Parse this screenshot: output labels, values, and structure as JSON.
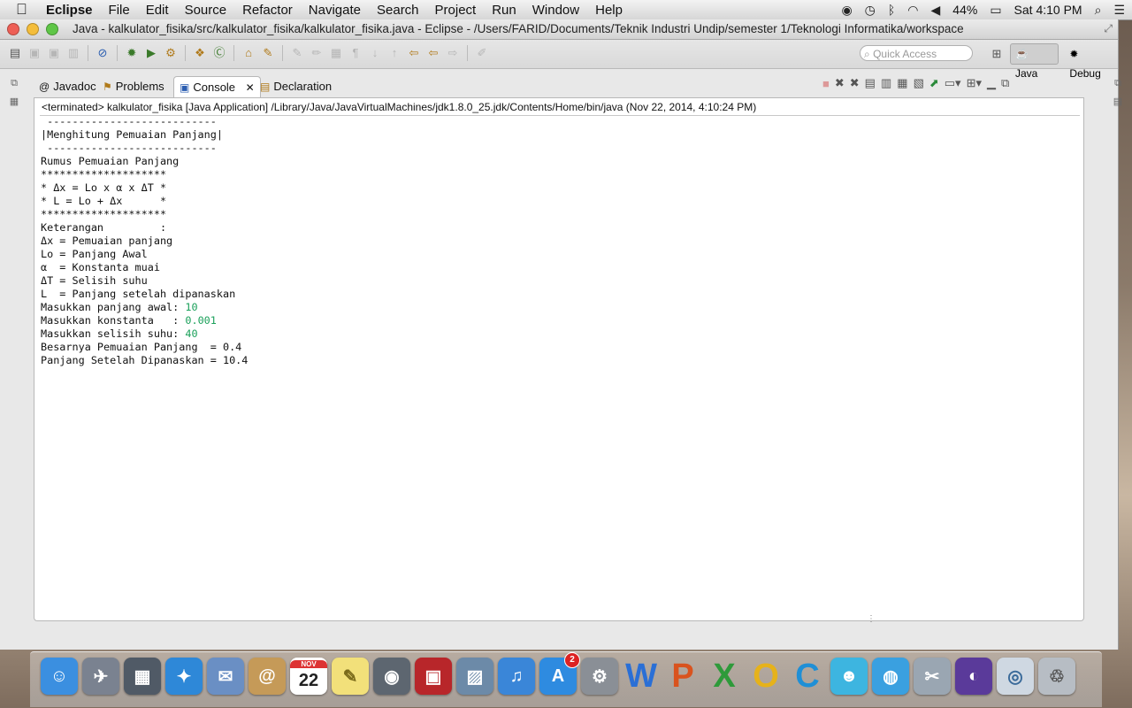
{
  "menubar": {
    "app_name": "Eclipse",
    "items": [
      "File",
      "Edit",
      "Source",
      "Refactor",
      "Navigate",
      "Search",
      "Project",
      "Run",
      "Window",
      "Help"
    ],
    "battery": "44%",
    "clock": "Sat 4:10 PM"
  },
  "window": {
    "title": "Java - kalkulator_fisika/src/kalkulator_fisika/kalkulator_fisika.java - Eclipse - /Users/FARID/Documents/Teknik Industri Undip/semester 1/Teknologi Informatika/workspace"
  },
  "toolbar": {
    "quick_access_placeholder": "Quick Access",
    "perspectives": [
      "Java",
      "Debug"
    ]
  },
  "tabs": [
    {
      "label": "Javadoc",
      "icon": "javadoc-icon"
    },
    {
      "label": "Problems",
      "icon": "problems-icon"
    },
    {
      "label": "Console",
      "icon": "console-icon"
    },
    {
      "label": "Declaration",
      "icon": "declaration-icon"
    }
  ],
  "console": {
    "header": "<terminated> kalkulator_fisika [Java Application] /Library/Java/JavaVirtualMachines/jdk1.8.0_25.jdk/Contents/Home/bin/java (Nov 22, 2014, 4:10:24 PM)",
    "lines": [
      {
        "text": " ---------------------------",
        "input": ""
      },
      {
        "text": "|Menghitung Pemuaian Panjang|",
        "input": ""
      },
      {
        "text": " ---------------------------",
        "input": ""
      },
      {
        "text": "Rumus Pemuaian Panjang",
        "input": ""
      },
      {
        "text": "********************",
        "input": ""
      },
      {
        "text": "* Δx = Lo x α x ΔT *",
        "input": ""
      },
      {
        "text": "* L = Lo + Δx      *",
        "input": ""
      },
      {
        "text": "********************",
        "input": ""
      },
      {
        "text": "Keterangan         :",
        "input": ""
      },
      {
        "text": "Δx = Pemuaian panjang",
        "input": ""
      },
      {
        "text": "Lo = Panjang Awal",
        "input": ""
      },
      {
        "text": "α  = Konstanta muai",
        "input": ""
      },
      {
        "text": "ΔT = Selisih suhu",
        "input": ""
      },
      {
        "text": "L  = Panjang setelah dipanaskan",
        "input": ""
      },
      {
        "text": "Masukkan panjang awal: ",
        "input": "10"
      },
      {
        "text": "Masukkan konstanta   : ",
        "input": "0.001"
      },
      {
        "text": "Masukkan selisih suhu: ",
        "input": "40"
      },
      {
        "text": "Besarnya Pemuaian Panjang  = 0.4",
        "input": ""
      },
      {
        "text": "Panjang Setelah Dipanaskan = 10.4",
        "input": ""
      }
    ]
  },
  "dock": {
    "calendar_day": "22",
    "calendar_month": "NOV",
    "appstore_badge": "2",
    "items": [
      "finder-icon",
      "launchpad-icon",
      "mission-control-icon",
      "safari-icon",
      "mail-icon",
      "contacts-icon",
      "calendar-icon",
      "notes-icon",
      "facetime-icon",
      "photo-booth-icon",
      "iphoto-icon",
      "itunes-icon",
      "app-store-icon",
      "system-preferences-icon",
      "word-icon",
      "powerpoint-icon",
      "excel-icon",
      "outlook-icon",
      "lync-icon",
      "messenger-icon",
      "network-icon",
      "directory-utility-icon",
      "eclipse-icon",
      "preview-icon",
      "trash-icon"
    ],
    "letters": {
      "word": "W",
      "powerpoint": "P",
      "excel": "X",
      "outlook": "O",
      "lync": "C"
    },
    "colors": {
      "word": "#2a6fd6",
      "powerpoint": "#d9531e",
      "excel": "#2e9a3a",
      "outlook": "#e6b21a",
      "lync": "#1f8fd6"
    }
  }
}
